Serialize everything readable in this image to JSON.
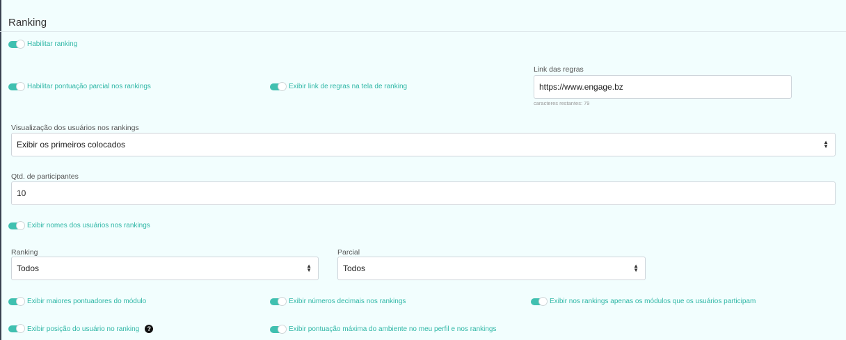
{
  "section": {
    "title": "Ranking"
  },
  "toggles": {
    "habilitar_ranking": "Habilitar ranking",
    "pontuacao_parcial": "Habilitar pontuação parcial nos rankings",
    "link_regras": "Exibir link de regras na tela de ranking",
    "nomes_usuarios": "Exibir nomes dos usuários nos rankings",
    "maiores_pontuadores": "Exibir maiores pontuadores do módulo",
    "numeros_decimais": "Exibir números decimais nos rankings",
    "apenas_modulos": "Exibir nos rankings apenas os módulos que os usuários participam",
    "posicao_usuario": "Exibir posição do usuário no ranking",
    "pontuacao_maxima": "Exibir pontuação máxima do ambiente no meu perfil e nos rankings"
  },
  "link_regras_field": {
    "label": "Link das regras",
    "value": "https://www.engage.bz",
    "hint": "caracteres restantes: 79"
  },
  "visualizacao": {
    "label": "Visualização dos usuários nos rankings",
    "selected": "Exibir os primeiros colocados"
  },
  "qtd_participantes": {
    "label": "Qtd. de participantes",
    "value": "10"
  },
  "ranking_select": {
    "label": "Ranking",
    "selected": "Todos"
  },
  "parcial_select": {
    "label": "Parcial",
    "selected": "Todos"
  },
  "help_icon": "?",
  "colors": {
    "accent": "#40c0b0",
    "label_accent": "#2fb7a6",
    "background": "#f2fefe"
  }
}
